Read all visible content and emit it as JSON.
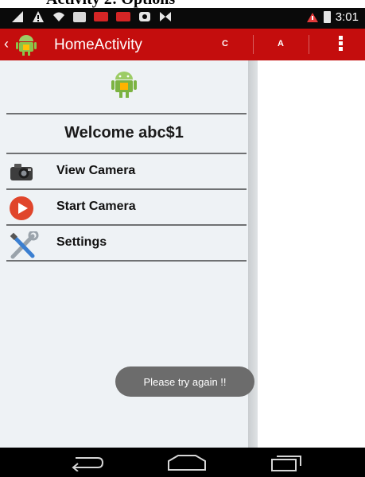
{
  "caption": "Activity 2: Options",
  "status_bar": {
    "time": "3:01",
    "icons": [
      "signal-icon",
      "warning-icon",
      "wifi-icon",
      "image-icon",
      "toi-icon",
      "toi-icon",
      "sync-icon",
      "bowtie-icon",
      "alert-icon",
      "battery-icon"
    ]
  },
  "action_bar": {
    "title": "HomeActivity",
    "action_c": "C",
    "action_a": "A"
  },
  "drawer": {
    "welcome": "Welcome abc$1",
    "items": [
      {
        "label": "View Camera",
        "icon": "camera-icon"
      },
      {
        "label": "Start Camera",
        "icon": "play-icon"
      },
      {
        "label": "Settings",
        "icon": "tools-icon"
      }
    ]
  },
  "toast": "Please try again !!",
  "colors": {
    "action_bar": "#c40d0d",
    "drawer_bg": "#eef2f5",
    "toast_bg": "#6c6c6c",
    "play_red": "#e0452b",
    "android_green": "#7cb342"
  }
}
